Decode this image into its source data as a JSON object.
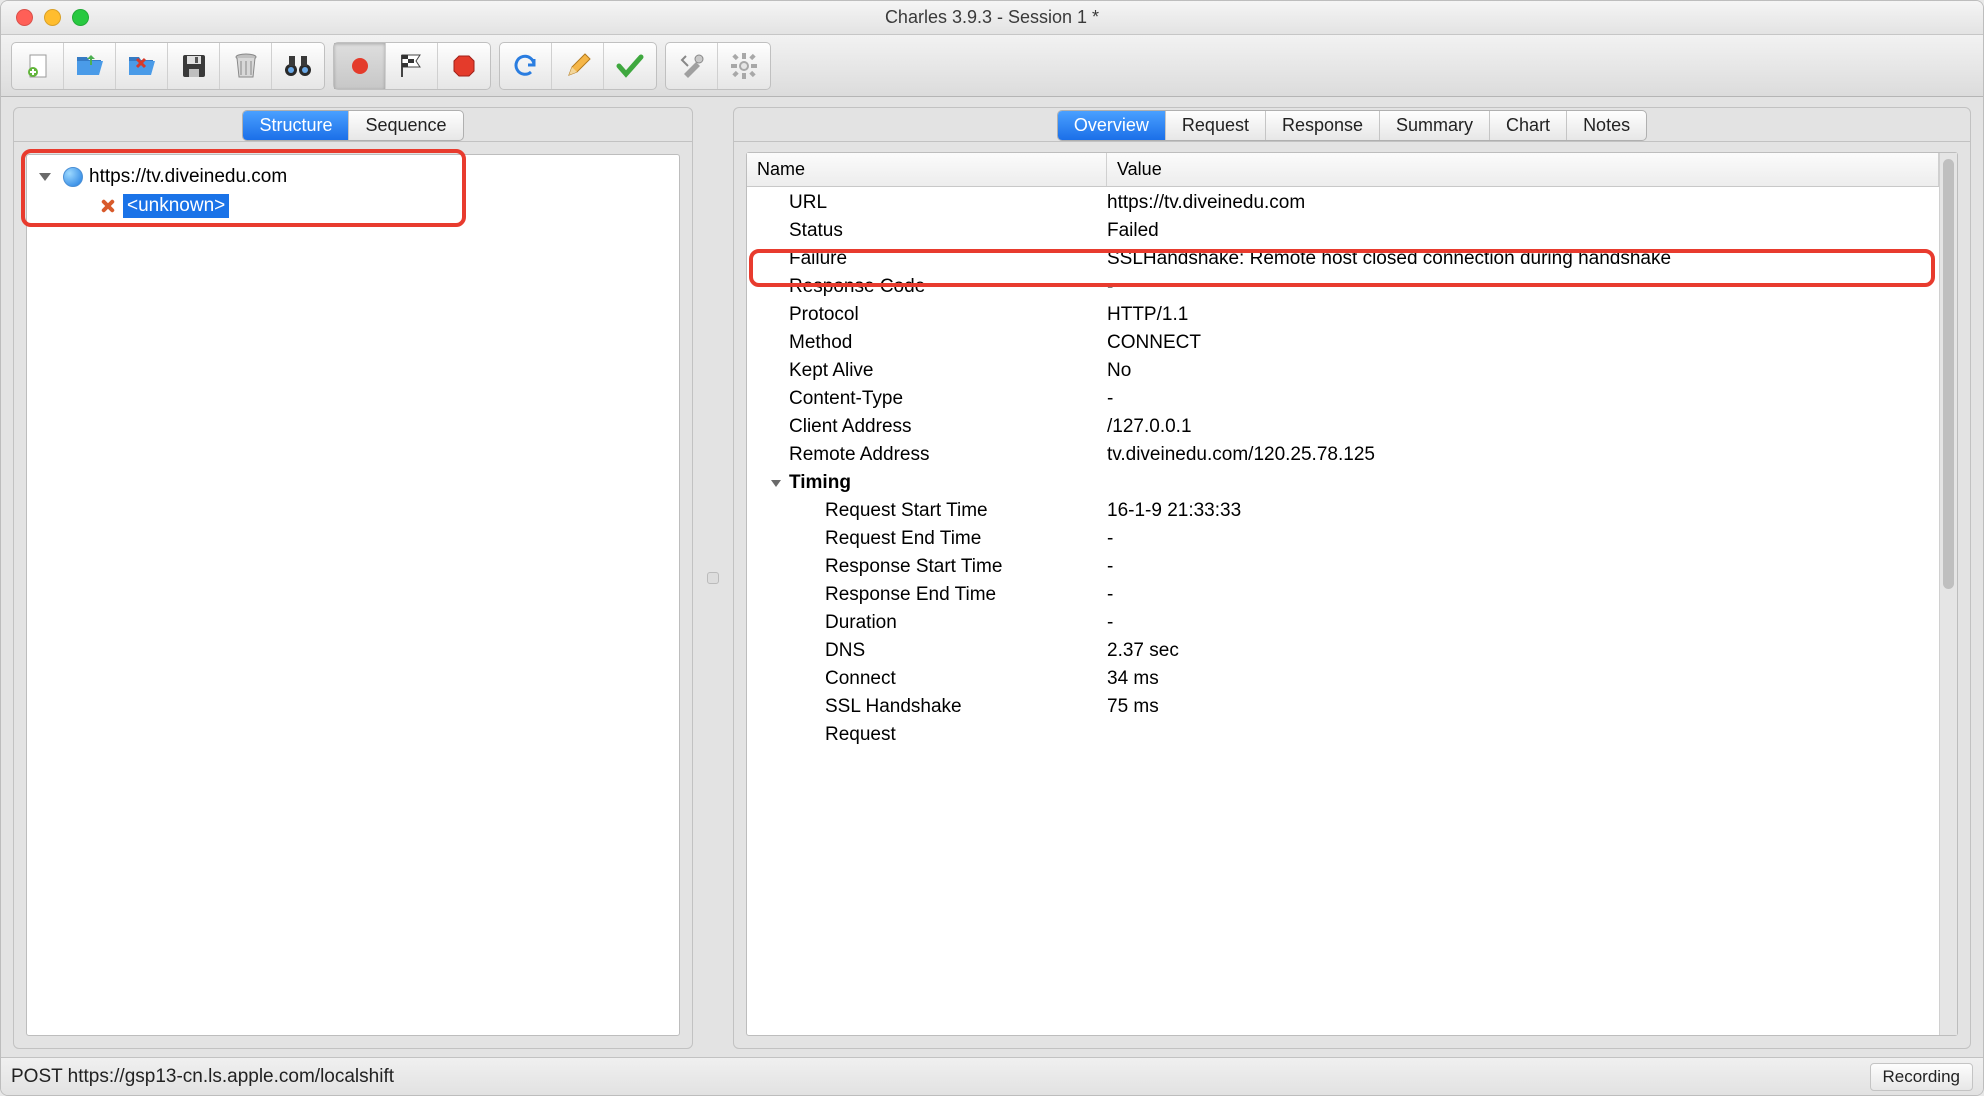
{
  "window": {
    "title": "Charles 3.9.3 - Session 1 *"
  },
  "left_tabs": {
    "structure": "Structure",
    "sequence": "Sequence"
  },
  "tree": {
    "host": "https://tv.diveinedu.com",
    "child": "<unknown>"
  },
  "right_tabs": {
    "overview": "Overview",
    "request": "Request",
    "response": "Response",
    "summary": "Summary",
    "chart": "Chart",
    "notes": "Notes"
  },
  "columns": {
    "name": "Name",
    "value": "Value"
  },
  "overview": {
    "url_k": "URL",
    "url_v": "https://tv.diveinedu.com",
    "status_k": "Status",
    "status_v": "Failed",
    "failure_k": "Failure",
    "failure_v": "SSLHandshake: Remote host closed connection during handshake",
    "respcode_k": "Response Code",
    "respcode_v": "-",
    "protocol_k": "Protocol",
    "protocol_v": "HTTP/1.1",
    "method_k": "Method",
    "method_v": "CONNECT",
    "keptalive_k": "Kept Alive",
    "keptalive_v": "No",
    "ctype_k": "Content-Type",
    "ctype_v": "-",
    "caddr_k": "Client Address",
    "caddr_v": "/127.0.0.1",
    "raddr_k": "Remote Address",
    "raddr_v": "tv.diveinedu.com/120.25.78.125",
    "timing_k": "Timing",
    "reqstart_k": "Request Start Time",
    "reqstart_v": "16-1-9 21:33:33",
    "reqend_k": "Request End Time",
    "reqend_v": "-",
    "resstart_k": "Response Start Time",
    "resstart_v": "-",
    "resend_k": "Response End Time",
    "resend_v": "-",
    "duration_k": "Duration",
    "duration_v": "-",
    "dns_k": "DNS",
    "dns_v": "2.37 sec",
    "connect_k": "Connect",
    "connect_v": "34 ms",
    "sslhs_k": "SSL Handshake",
    "sslhs_v": "75 ms",
    "request_k": "Request",
    "request_v": ""
  },
  "status": {
    "left": "POST https://gsp13-cn.ls.apple.com/localshift",
    "right": "Recording"
  }
}
